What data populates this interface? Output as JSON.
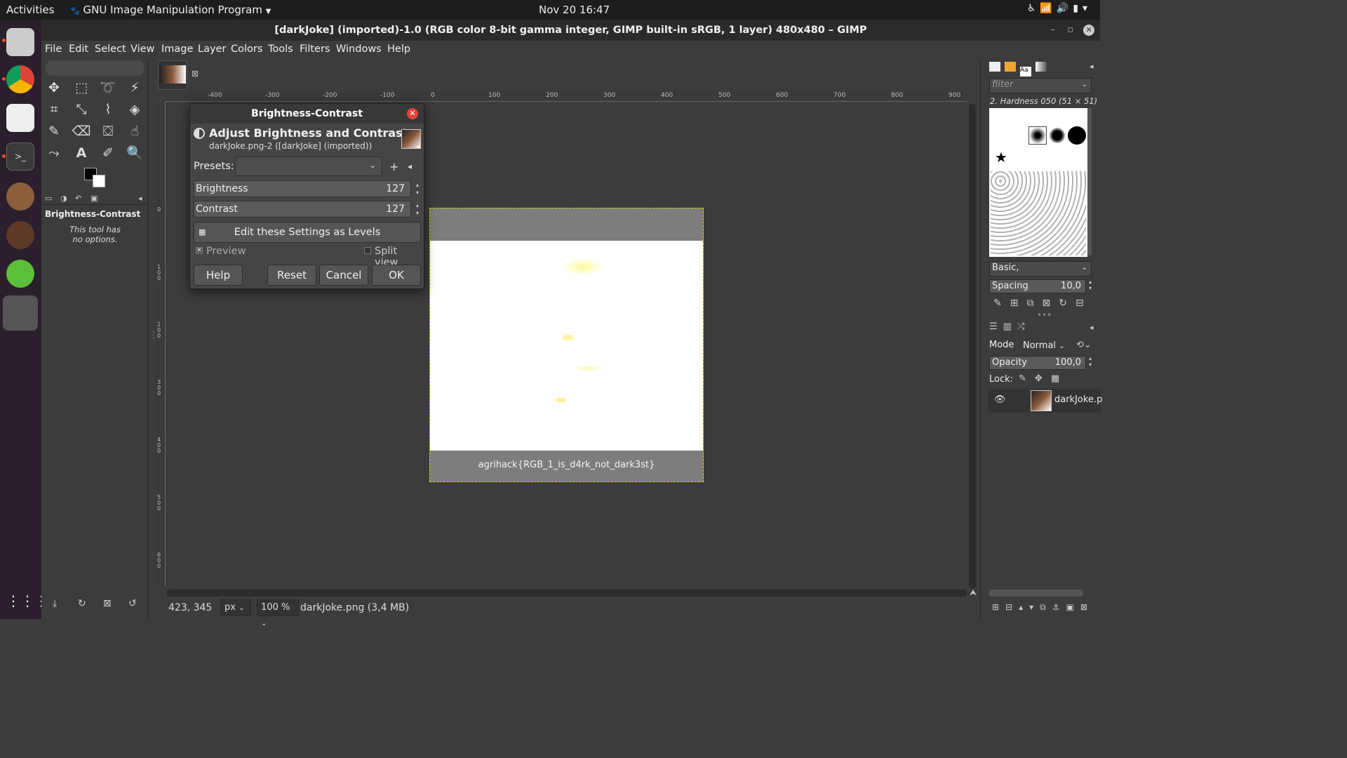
{
  "topbar": {
    "activities": "Activities",
    "app_menu": "GNU Image Manipulation Program",
    "clock": "Nov 20  16:47"
  },
  "window": {
    "title": "[darkJoke] (imported)-1.0 (RGB color 8-bit gamma integer, GIMP built-in sRGB, 1 layer) 480x480 – GIMP"
  },
  "menu": [
    "File",
    "Edit",
    "Select",
    "View",
    "Image",
    "Layer",
    "Colors",
    "Tools",
    "Filters",
    "Windows",
    "Help"
  ],
  "tool_options": {
    "title": "Brightness-Contrast",
    "no_options_line1": "This tool has",
    "no_options_line2": "no options."
  },
  "ruler": {
    "h_ticks": [
      "-400",
      "-300",
      "-200",
      "-100",
      "0",
      "100",
      "200",
      "300",
      "400",
      "500",
      "600",
      "700",
      "800",
      "900"
    ],
    "v_ticks": [
      "0",
      "100",
      "200",
      "300",
      "400",
      "500",
      "600"
    ]
  },
  "image": {
    "flag_text": "agrihack{RGB_1_is_d4rk_not_dark3st}"
  },
  "dialog": {
    "title": "Brightness-Contrast",
    "heading": "Adjust Brightness and Contrast",
    "subtitle": "darkJoke.png-2 ([darkJoke] (imported))",
    "presets_label": "Presets:",
    "brightness_label": "Brightness",
    "brightness_value": "127",
    "contrast_label": "Contrast",
    "contrast_value": "127",
    "levels_button": "Edit these Settings as Levels",
    "preview_label": "Preview",
    "split_view_label": "Split view",
    "help": "Help",
    "reset": "Reset",
    "cancel": "Cancel",
    "ok": "OK"
  },
  "statusbar": {
    "coords": "423, 345",
    "unit": "px",
    "zoom": "100 %",
    "file": "darkJoke.png (3,4 MB)"
  },
  "brushes": {
    "filter_placeholder": "filter",
    "selected": "2. Hardness 050 (51 × 51)",
    "tag": "Basic,",
    "spacing_label": "Spacing",
    "spacing_value": "10,0"
  },
  "layers": {
    "mode_label": "Mode",
    "mode_value": "Normal",
    "opacity_label": "Opacity",
    "opacity_value": "100,0",
    "lock_label": "Lock:",
    "layer_name": "darkJoke.p"
  }
}
